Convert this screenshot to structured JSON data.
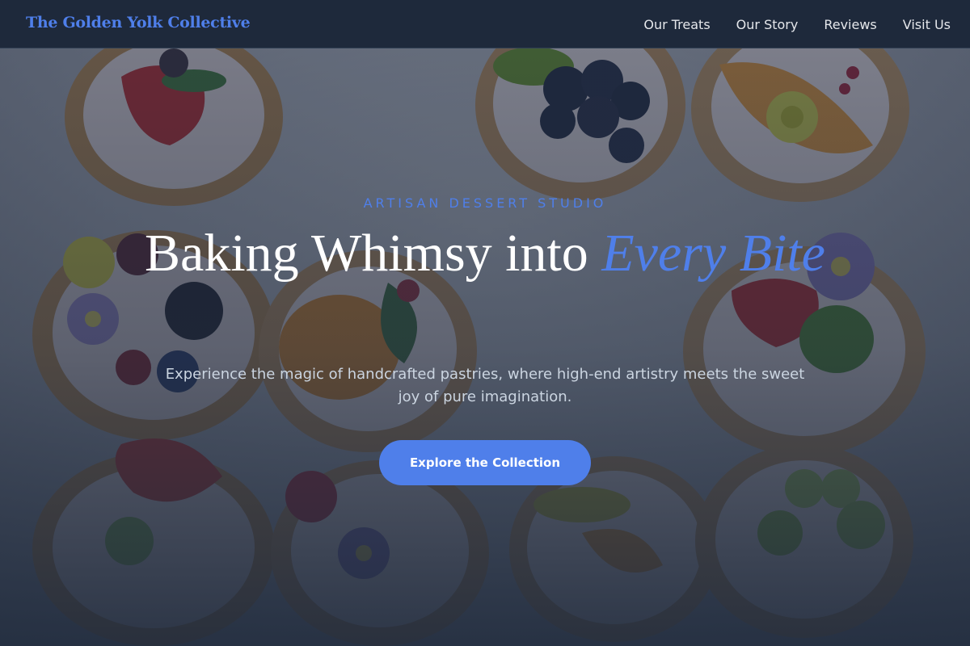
{
  "brand": {
    "name": "The Golden Yolk Collective"
  },
  "nav": {
    "links": [
      {
        "label": "Our Treats"
      },
      {
        "label": "Our Story"
      },
      {
        "label": "Reviews"
      },
      {
        "label": "Visit Us"
      }
    ]
  },
  "hero": {
    "eyebrow": "ARTISAN DESSERT STUDIO",
    "title_main": "Baking Whimsy into ",
    "title_accent": "Every Bite",
    "subtitle": "Experience the magic of handcrafted pastries, where high-end artistry meets the sweet joy of pure imagination.",
    "cta_label": "Explore the Collection",
    "background_image": "fruit-topped-tarts-photo"
  },
  "colors": {
    "accent": "#4f7fea",
    "nav_background": "#1e293b",
    "hero_overlay": "#1e293b",
    "subtitle_text": "#cbd5e1"
  }
}
